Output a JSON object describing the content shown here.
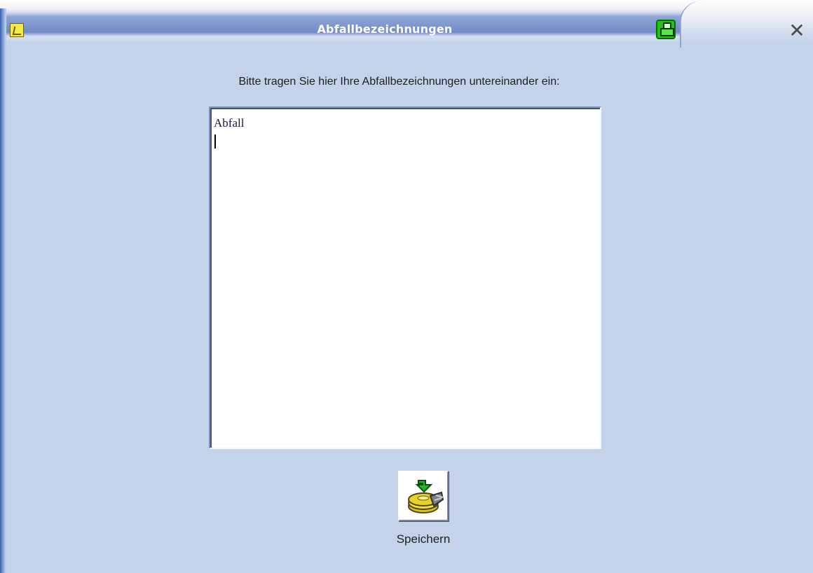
{
  "window": {
    "title": "Abfallbezeichnungen",
    "close_symbol": "✕",
    "icons": {
      "app_icon": "document-icon",
      "print_button": "printer-icon",
      "close_button": "close-icon"
    }
  },
  "form": {
    "instruction": "Bitte tragen Sie hier Ihre Abfallbezeichnungen untereinander ein:",
    "textarea_value": "Abfall"
  },
  "actions": {
    "save_label": "Speichern",
    "save_icon": "save-disk-icon"
  },
  "colors": {
    "window_background": "#c2d3ea",
    "title_text": "#ffffff",
    "print_button": "#22c418"
  }
}
